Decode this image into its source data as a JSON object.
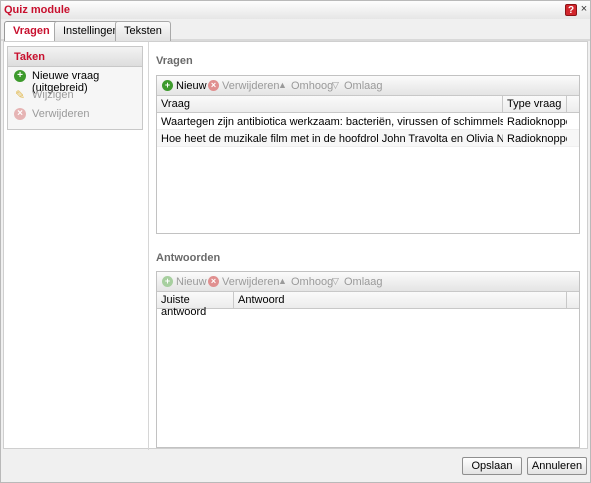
{
  "window": {
    "title": "Quiz module",
    "help": "?",
    "close": "×"
  },
  "tabs": [
    {
      "label": "Vragen"
    },
    {
      "label": "Instellingen"
    },
    {
      "label": "Teksten"
    }
  ],
  "tasks": {
    "header": "Taken",
    "items": [
      {
        "label": "Nieuwe vraag (uitgebreid)",
        "icon": "add-icon",
        "enabled": true
      },
      {
        "label": "Wijzigen",
        "icon": "pencil-icon",
        "enabled": false
      },
      {
        "label": "Verwijderen",
        "icon": "delete-icon",
        "enabled": false
      }
    ]
  },
  "toolbar": {
    "new": "Nieuw",
    "delete": "Verwijderen",
    "up": "Omhoog",
    "down": "Omlaag"
  },
  "vragen": {
    "title": "Vragen",
    "columns": [
      "Vraag",
      "Type vraag"
    ],
    "rows": [
      [
        "Waartegen zijn antibiotica werkzaam: bacteriën, virussen of schimmels?",
        "Radioknoppen"
      ],
      [
        "Hoe heet de muzikale film met in de hoofdrol John Travolta en Olivia Newton John?",
        "Radioknoppen"
      ]
    ]
  },
  "antwoorden": {
    "title": "Antwoorden",
    "columns": [
      "Juiste antwoord",
      "Antwoord"
    ]
  },
  "footer": {
    "save": "Opslaan",
    "cancel": "Annuleren"
  },
  "colors": {
    "accent": "#c8102e",
    "add": "#3d9a2c",
    "disabled": "#9a9a9a"
  }
}
